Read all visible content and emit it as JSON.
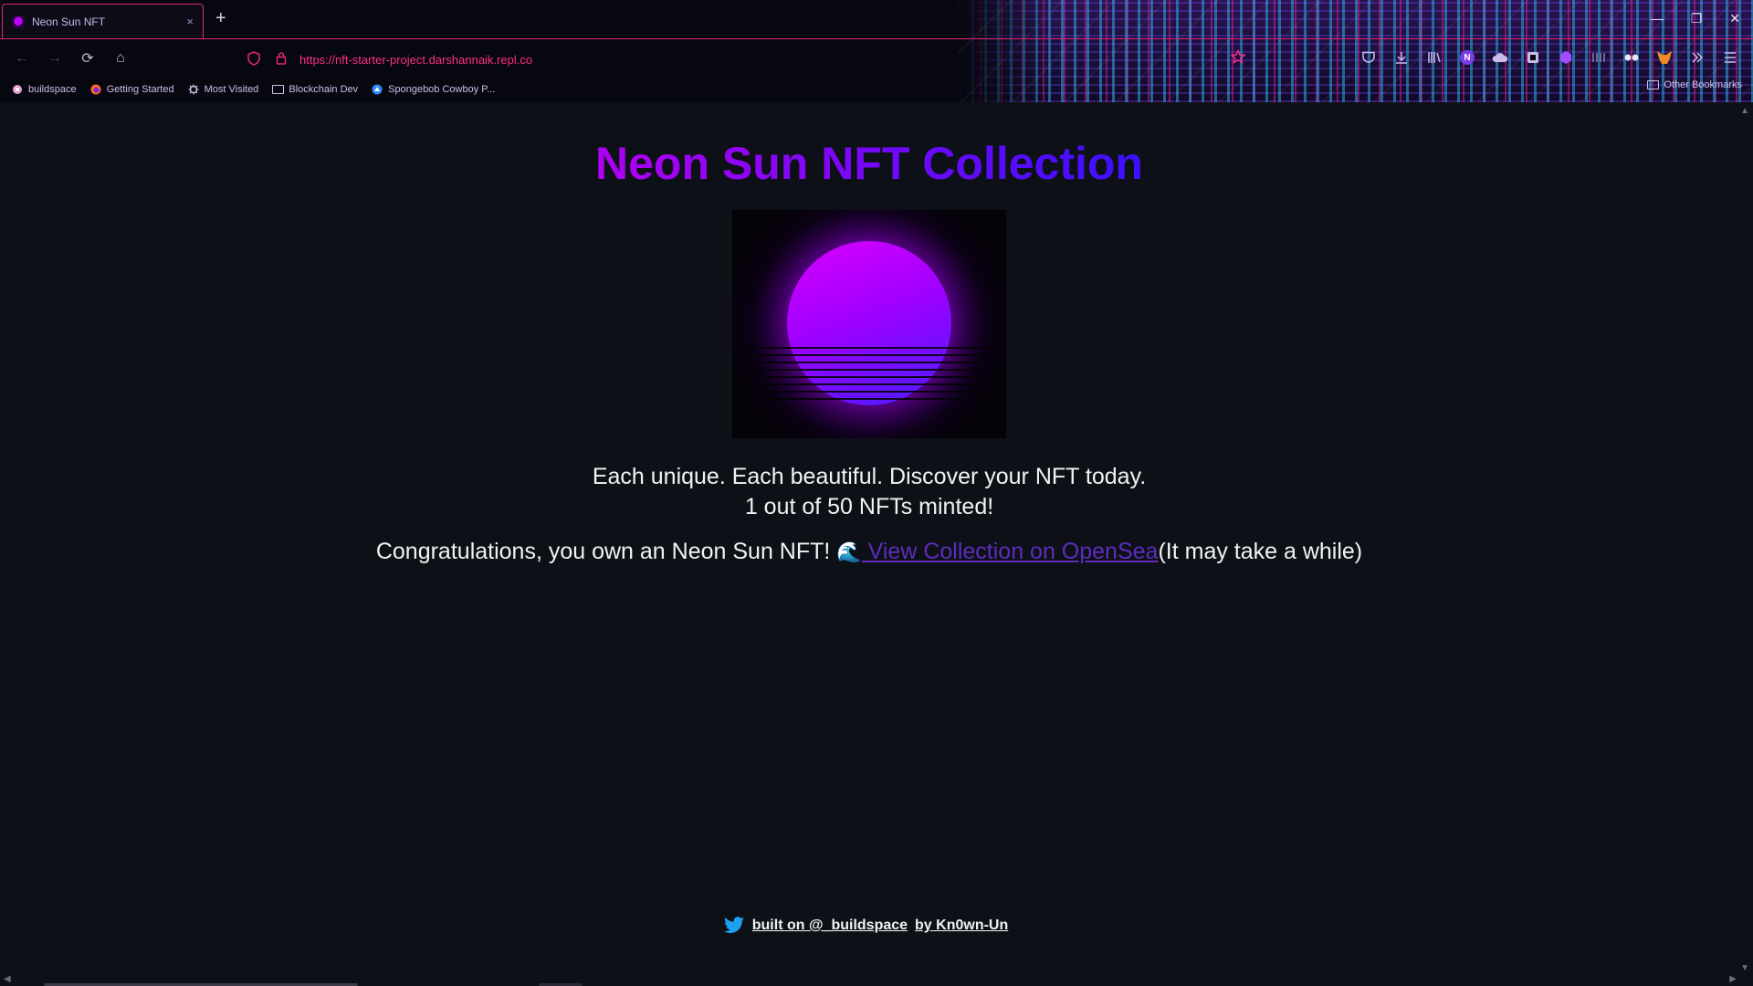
{
  "browser": {
    "tab": {
      "title": "Neon Sun NFT",
      "close": "×"
    },
    "new_tab": "+",
    "window_controls": [
      "—",
      "❐",
      "✕"
    ],
    "nav": {
      "back": "←",
      "forward": "→",
      "reload": "⟳",
      "home": "⌂"
    },
    "url": "https://nft-starter-project.darshannaik.repl.co",
    "bookmarks": [
      {
        "label": "buildspace",
        "icon": "buildspace-icon"
      },
      {
        "label": "Getting Started",
        "icon": "firefox-icon"
      },
      {
        "label": "Most Visited",
        "icon": "gear-icon"
      },
      {
        "label": "Blockchain Dev",
        "icon": "folder-icon"
      },
      {
        "label": "Spongebob Cowboy P...",
        "icon": "site-icon"
      }
    ],
    "other_bookmarks": "Other Bookmarks",
    "extensions": [
      "pocket-icon",
      "download-icon",
      "library-icon",
      "notion-icon",
      "cloud-icon",
      "extension-icon",
      "hex-icon",
      "bars-icon",
      "mask-icon",
      "metamask-icon",
      "overflow-icon",
      "menu-icon"
    ],
    "extension_chip": "N"
  },
  "page": {
    "title": "Neon Sun NFT Collection",
    "tagline": "Each unique. Each beautiful. Discover your NFT today.",
    "minted": "1 out of 50 NFTs minted!",
    "congrats": "Congratulations, you own an Neon Sun NFT! ",
    "wave": "🌊",
    "opensea_link": " View Collection on OpenSea",
    "suffix": "(It may take a while)",
    "footer": {
      "built_on": "built on @_buildspace",
      "by": "by Kn0wn-Un"
    }
  },
  "colors": {
    "accent": "#e4267b",
    "url": "#ff2e88",
    "title_start": "#b000f0",
    "title_end": "#3a10ff",
    "link": "#5f2bbd",
    "background": "#0d1117"
  }
}
